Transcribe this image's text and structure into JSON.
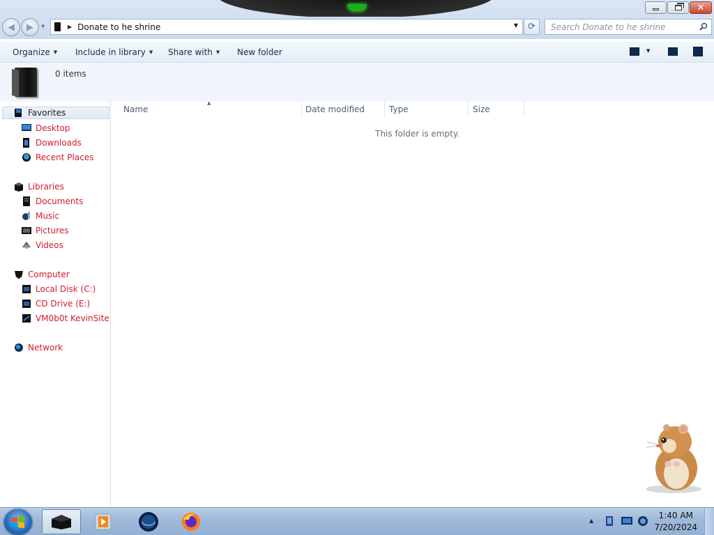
{
  "window": {
    "address_segment": "Donate to he shrine",
    "search_placeholder": "Search Donate to he shrine",
    "minimize_icon": "minimize-icon",
    "maximize_icon": "restore-icon",
    "close_icon": "close-icon"
  },
  "toolbar": {
    "organize": "Organize",
    "include_in_library": "Include in library",
    "share_with": "Share with",
    "new_folder": "New folder"
  },
  "details": {
    "item_count": "0 items"
  },
  "navpane": {
    "favorites": {
      "label": "Favorites",
      "items": [
        "Desktop",
        "Downloads",
        "Recent Places"
      ]
    },
    "libraries": {
      "label": "Libraries",
      "items": [
        "Documents",
        "Music",
        "Pictures",
        "Videos"
      ]
    },
    "computer": {
      "label": "Computer",
      "items": [
        "Local Disk (C:)",
        "CD Drive (E:)",
        "VM0b0t KevinSite"
      ]
    },
    "network": {
      "label": "Network"
    }
  },
  "columns": [
    "Name",
    "Date modified",
    "Type",
    "Size"
  ],
  "content": {
    "empty_message": "This folder is empty."
  },
  "taskbar": {
    "pinned": [
      "explorer-icon",
      "media-player-icon",
      "browser-globe-icon",
      "firefox-icon"
    ],
    "clock_time": "1:40 AM",
    "clock_date": "7/20/2024"
  },
  "colors": {
    "nav_text": "#d41a2e",
    "accent": "#3867a8",
    "taskbar": "#9fb9d9"
  }
}
